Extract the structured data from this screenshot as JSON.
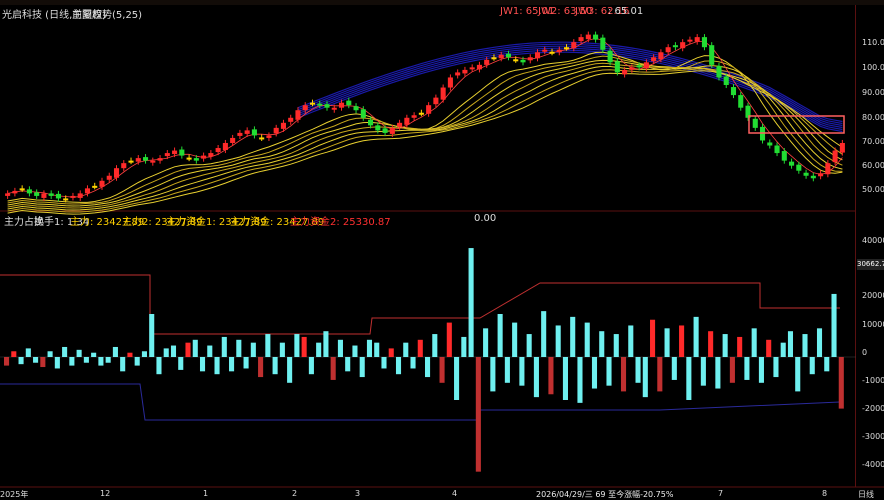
{
  "main_title": {
    "stock": "光启科技 (日线,前复权)",
    "indicator": "主图趋势(5,25)",
    "jw1": "JW1: 65.01",
    "jw2": "JW2: 63.50",
    "jw3": "JW3: 62.16",
    "value": ": 65.01"
  },
  "sub_indicator": {
    "name": "主力占比",
    "turnover": "换手1: 1.34",
    "zl": "主力: 23427.89",
    "zl2": "主力2: 23427.89",
    "zlzj1": "主力资金1: 23427.89",
    "zlzj": "主力资金: 23427.89",
    "zlzj2": "主力资金2: 25330.87",
    "extra": "0.00"
  },
  "price_axis": [
    "110.00",
    "100.00",
    "90.00",
    "80.00",
    "70.00",
    "60.00",
    "50.00"
  ],
  "volume_axis": [
    "40000",
    "30000",
    "20000",
    "10000",
    "0",
    "-10000",
    "-20000",
    "-30000",
    "-40000"
  ],
  "cursor_value": "30662.77",
  "x_axis": {
    "labels": [
      "2025年",
      "12",
      "1",
      "2",
      "3",
      "4",
      "7",
      "8"
    ],
    "cursor_date": "2026/04/29/三 69 至今涨幅-20.75%",
    "period": "日线"
  },
  "colors": {
    "up": "#ff2a2a",
    "down": "#22dd33",
    "doji": "#ffd400",
    "cyan_bar": "#6ff0f0",
    "ribbon": "#d4c21a",
    "blue_arc": "#1a1aa8"
  },
  "chart_data": {
    "type": "candlestick",
    "price_ylim": [
      45,
      118
    ],
    "price_closes": [
      50,
      51,
      52,
      50,
      49,
      50,
      49,
      48,
      48,
      49,
      50,
      52,
      53,
      55,
      57,
      60,
      62,
      63,
      64,
      63,
      63,
      64,
      66,
      67,
      65,
      64,
      63,
      65,
      66,
      68,
      70,
      72,
      74,
      75,
      73,
      72,
      73,
      76,
      78,
      80,
      83,
      85,
      86,
      85,
      84,
      84,
      86,
      85,
      83,
      80,
      77,
      75,
      74,
      76,
      78,
      80,
      81,
      82,
      85,
      88,
      92,
      96,
      98,
      99,
      100,
      101,
      103,
      104,
      105,
      104,
      103,
      102,
      104,
      106,
      107,
      106,
      107,
      108,
      110,
      112,
      113,
      111,
      107,
      102,
      98,
      99,
      100,
      100,
      102,
      104,
      106,
      108,
      108,
      110,
      111,
      112,
      108,
      101,
      96,
      93,
      89,
      84,
      80,
      76,
      71,
      69,
      66,
      63,
      61,
      59,
      57,
      56,
      58,
      62,
      67,
      70
    ],
    "flow_ylim": [
      -45000,
      45000
    ],
    "flow_values": [
      -3000,
      2000,
      -2500,
      3000,
      -2000,
      -3500,
      2000,
      -4000,
      3500,
      -3000,
      2500,
      -2000,
      1500,
      -3000,
      -2000,
      3500,
      -5000,
      1500,
      -3000,
      2000,
      15000,
      -6000,
      3000,
      4000,
      -4500,
      5000,
      6000,
      -5000,
      4000,
      -6000,
      7000,
      -5000,
      6000,
      -4000,
      5000,
      -7000,
      8000,
      -6000,
      5000,
      -9000,
      8000,
      7000,
      -6000,
      5000,
      9000,
      -8000,
      6000,
      -5000,
      4000,
      -7000,
      6000,
      5000,
      -4000,
      3000,
      -6000,
      5000,
      -4000,
      6000,
      -7000,
      8000,
      -9000,
      12000,
      -15000,
      7000,
      38000,
      -40000,
      10000,
      -12000,
      15000,
      -9000,
      12000,
      -10000,
      8000,
      -14000,
      16000,
      -13000,
      11000,
      -15000,
      14000,
      -16000,
      12000,
      -11000,
      9000,
      -10000,
      8000,
      -12000,
      11000,
      -9000,
      -14000,
      13000,
      -12000,
      10000,
      -8000,
      11000,
      -15000,
      14000,
      -10000,
      9000,
      -11000,
      8000,
      -9000,
      7000,
      -8000,
      10000,
      -9000,
      6000,
      -7000,
      5000,
      9000,
      -12000,
      8000,
      -6000,
      10000,
      -5000,
      22000,
      -18000
    ]
  }
}
